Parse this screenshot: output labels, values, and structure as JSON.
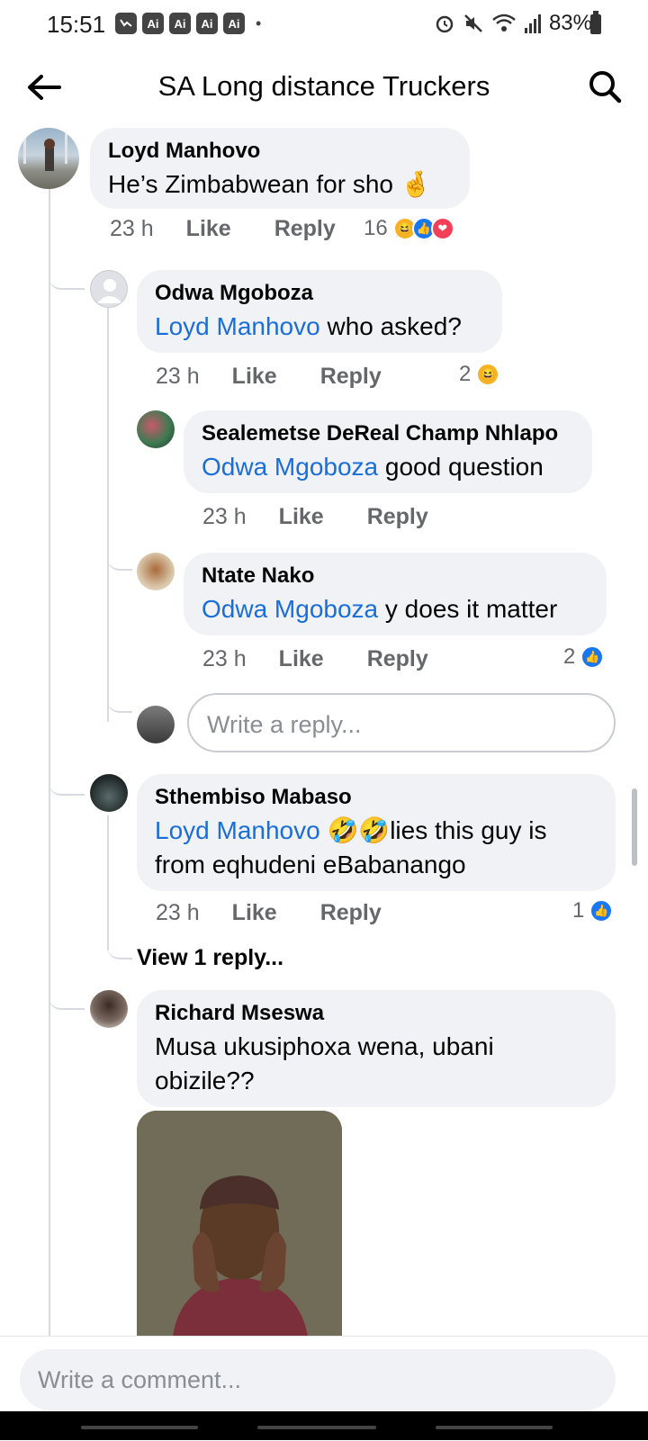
{
  "status": {
    "time": "15:51",
    "notif_icons": [
      "messenger-icon",
      "ai-icon",
      "ai-icon",
      "ai-icon",
      "ai-icon"
    ],
    "ai_label": "Ai",
    "battery": "83%"
  },
  "header": {
    "title": "SA Long distance Truckers"
  },
  "comments": [
    {
      "name": "Loyd Manhovo",
      "text": "He’s Zimbabwean for sho 🤞",
      "time": "23 h",
      "like": "Like",
      "reply": "Reply",
      "reaction_count": "16",
      "reactions": [
        "haha",
        "like",
        "love"
      ]
    },
    {
      "name": "Odwa Mgoboza",
      "mention": "Loyd Manhovo",
      "text": " who asked?",
      "time": "23 h",
      "like": "Like",
      "reply": "Reply",
      "reaction_count": "2",
      "reactions": [
        "haha"
      ]
    },
    {
      "name": "Sealemetse DeReal Champ Nhlapo",
      "mention": "Odwa Mgoboza",
      "text": " good question",
      "time": "23 h",
      "like": "Like",
      "reply": "Reply"
    },
    {
      "name": "Ntate Nako",
      "mention": "Odwa Mgoboza",
      "text": " y does it matter",
      "time": "23 h",
      "like": "Like",
      "reply": "Reply",
      "reaction_count": "2",
      "reactions": [
        "like"
      ]
    },
    {
      "name": "Sthembiso Mabaso",
      "mention": "Loyd Manhovo",
      "text": " 🤣🤣lies this guy is from eqhudeni eBabanango",
      "time": "23 h",
      "like": "Like",
      "reply": "Reply",
      "reaction_count": "1",
      "reactions": [
        "like"
      ]
    },
    {
      "name": "Richard Mseswa",
      "text": "Musa ukusiphoxa wena, ubani obizile??"
    }
  ],
  "reply_placeholder": "Write a reply...",
  "view_more": "View 1 reply...",
  "comment_placeholder": "Write a comment..."
}
